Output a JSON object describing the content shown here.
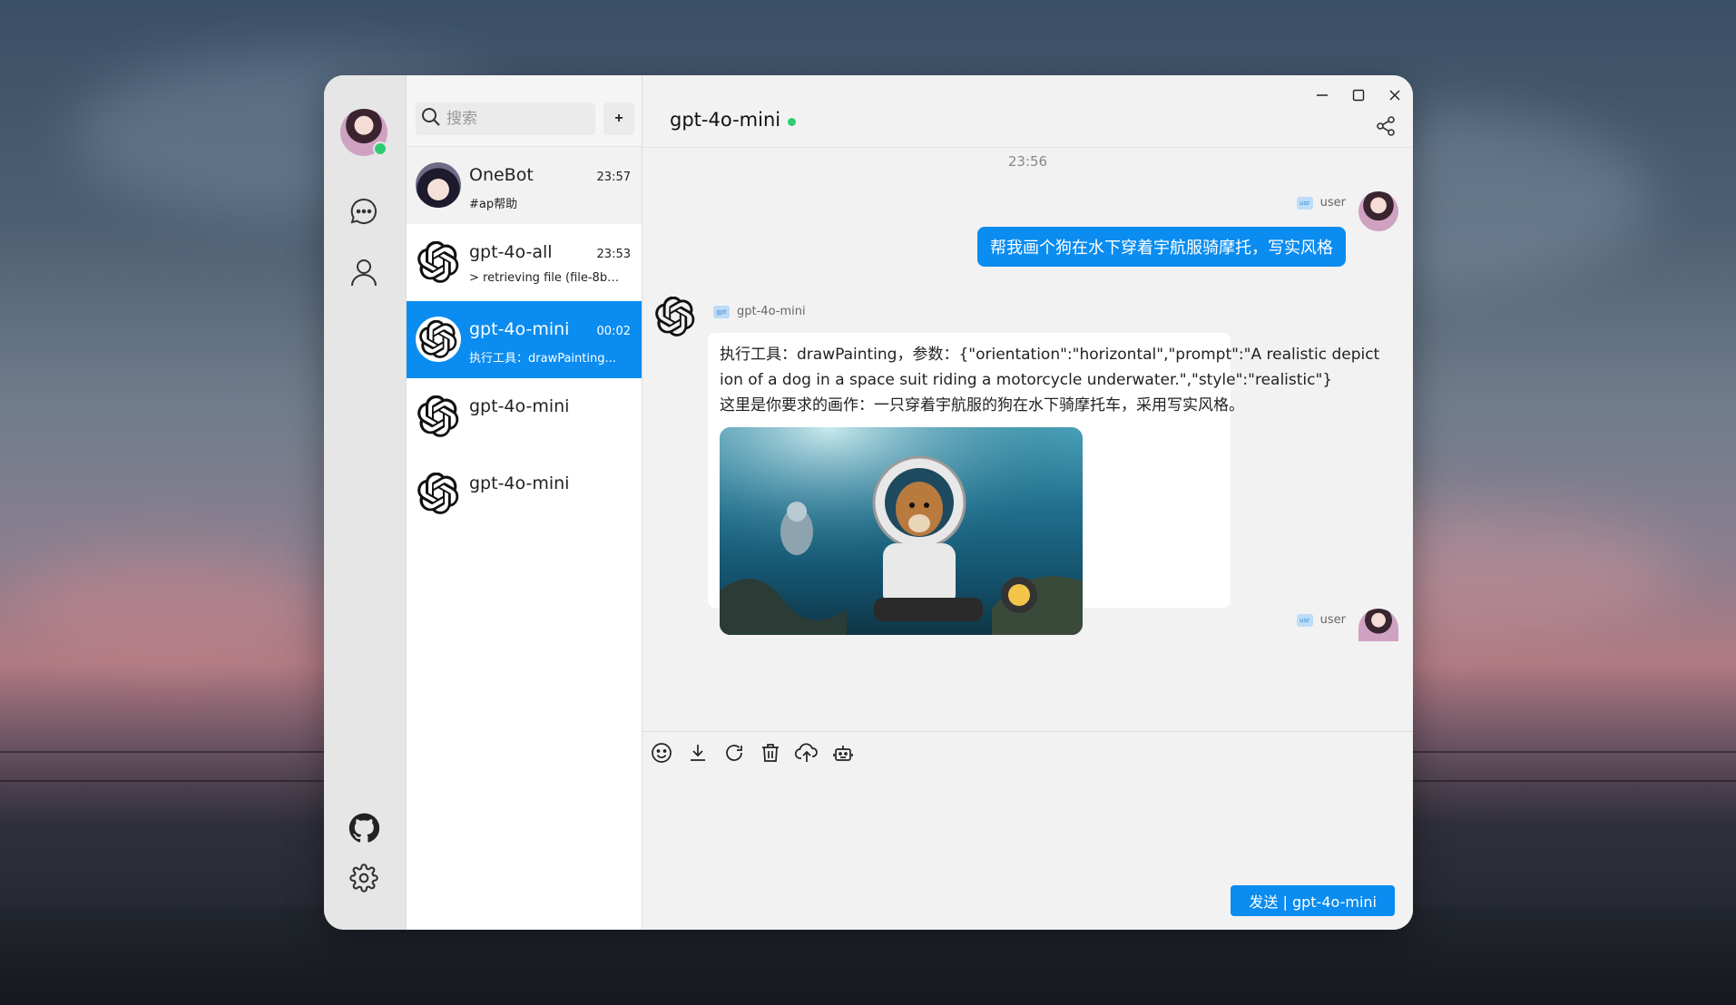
{
  "window": {
    "accent": "#0a8cf0",
    "online_color": "#2ecc71"
  },
  "rail": {
    "icons": [
      "chat-bubble-icon",
      "user-icon",
      "github-icon",
      "gear-icon"
    ]
  },
  "search": {
    "placeholder": "搜索",
    "add_label": "+"
  },
  "conversations": [
    {
      "name": "OneBot",
      "time": "23:57",
      "preview": "#ap帮助"
    },
    {
      "name": "gpt-4o-all",
      "time": "23:53",
      "preview": "> retrieving file (file-8bP..."
    },
    {
      "name": "gpt-4o-mini",
      "time": "00:02",
      "preview": "执行工具：drawPainting..."
    },
    {
      "name": "gpt-4o-mini",
      "time": "",
      "preview": ""
    },
    {
      "name": "gpt-4o-mini",
      "time": "",
      "preview": ""
    }
  ],
  "chat": {
    "title": "gpt-4o-mini",
    "timestamp": "23:56",
    "user_label": "user",
    "tag_text": "usr",
    "bot_tag_text": "gpt",
    "user_message": "帮我画个狗在水下穿着宇航服骑摩托，写实风格",
    "bot_name": "gpt-4o-mini",
    "bot_line1": "执行工具：drawPainting，参数：{\"orientation\":\"horizontal\",\"prompt\":\"A realistic depict",
    "bot_line2": "ion of a dog in a space suit riding a motorcycle underwater.\",\"style\":\"realistic\"}",
    "bot_line3": "这里是你要求的画作：一只穿着宇航服的狗在水下骑摩托车，采用写实风格。",
    "second_user_label": "user"
  },
  "composer": {
    "tools": [
      "emoji-icon",
      "download-icon",
      "refresh-icon",
      "trash-icon",
      "upload-cloud-icon",
      "robot-icon"
    ],
    "send_label": "发送 | gpt-4o-mini"
  }
}
